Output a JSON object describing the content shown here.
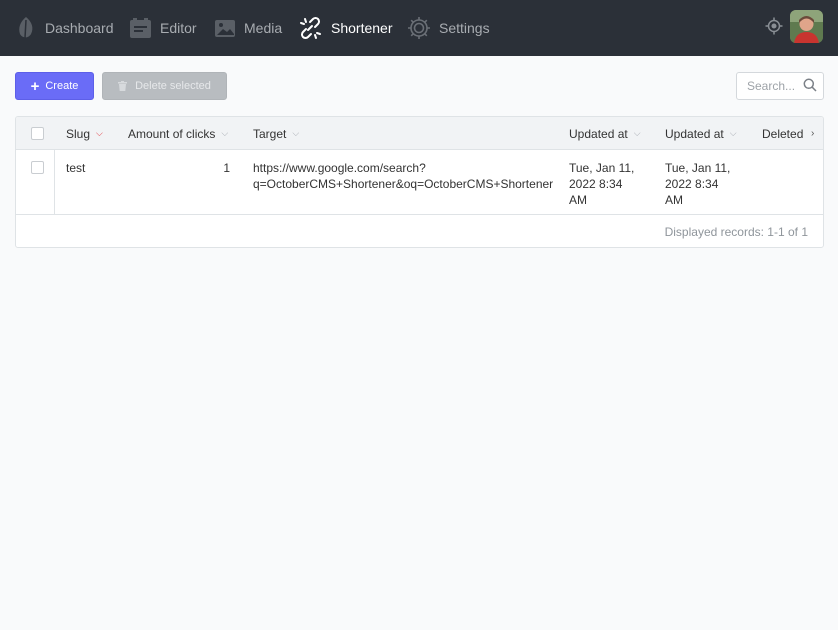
{
  "nav": {
    "items": [
      {
        "label": "Dashboard",
        "icon": "leaf-icon"
      },
      {
        "label": "Editor",
        "icon": "editor-icon"
      },
      {
        "label": "Media",
        "icon": "media-icon"
      },
      {
        "label": "Shortener",
        "icon": "link-icon",
        "active": true
      },
      {
        "label": "Settings",
        "icon": "gear-icon"
      }
    ],
    "right_icons": [
      "crosshair-icon",
      "avatar"
    ]
  },
  "toolbar": {
    "create_label": "Create",
    "delete_label": "Delete selected",
    "search_placeholder": "Search..."
  },
  "table": {
    "columns": [
      "Slug",
      "Amount of clicks",
      "Target",
      "Updated at",
      "Updated at",
      "Deleted"
    ],
    "sorted_column": "Slug",
    "rows": [
      {
        "slug": "test",
        "clicks": "1",
        "target_line1": "https://www.google.com/search?",
        "target_line2": "q=OctoberCMS+Shortener&oq=OctoberCMS+Shortener",
        "updated1_line1": "Tue, Jan 11,",
        "updated1_line2": "2022 8:34",
        "updated1_line3": "AM",
        "updated2_line1": "Tue, Jan 11,",
        "updated2_line2": "2022 8:34",
        "updated2_line3": "AM"
      }
    ],
    "footer": "Displayed records: 1-1 of 1"
  },
  "colors": {
    "topbar": "#2b3038",
    "accent": "#6a6cf7",
    "sort_indicator": "#e0343c"
  }
}
